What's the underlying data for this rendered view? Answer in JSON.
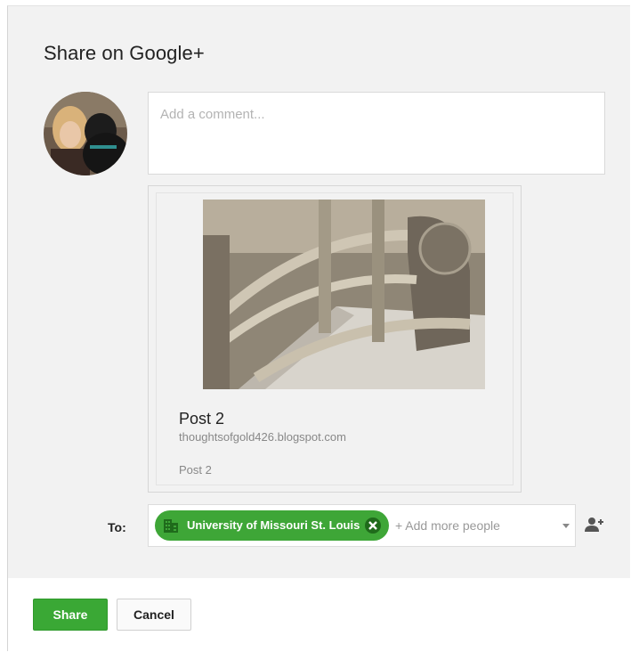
{
  "dialog": {
    "title": "Share on Google+"
  },
  "comment": {
    "placeholder": "Add a comment..."
  },
  "link_card": {
    "title": "Post 2",
    "url": "thoughtsofgold426.blogspot.com",
    "description": "Post 2"
  },
  "audience": {
    "label": "To:",
    "chip_label": "University of Missouri St. Louis",
    "chip_icon": "building-icon",
    "add_placeholder": "+ Add more people",
    "add_person_icon": "add-person-icon"
  },
  "footer": {
    "share_label": "Share",
    "cancel_label": "Cancel"
  },
  "colors": {
    "share_green": "#3aa835",
    "chip_green": "#3ea637",
    "background": "#f2f2f2"
  }
}
